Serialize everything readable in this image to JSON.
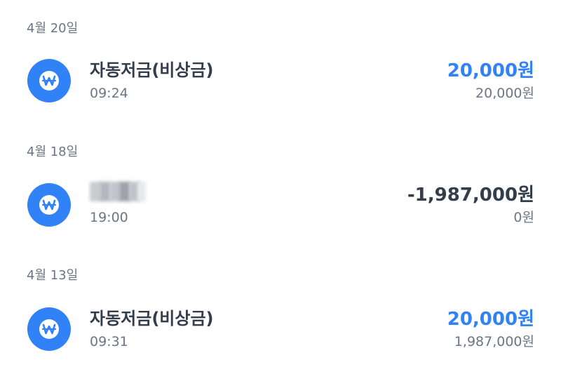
{
  "groups": [
    {
      "date": "4월 20일",
      "tx": {
        "title": "자동저금(비상금)",
        "time": "09:24",
        "amount": "20,000원",
        "balance": "20,000원",
        "direction": "in",
        "icon": "won-icon"
      }
    },
    {
      "date": "4월 18일",
      "tx": {
        "title_obscured": true,
        "time": "19:00",
        "amount": "-1,987,000원",
        "balance": "0원",
        "direction": "out",
        "icon": "won-icon"
      }
    },
    {
      "date": "4월 13일",
      "tx": {
        "title": "자동저금(비상금)",
        "time": "09:31",
        "amount": "20,000원",
        "balance": "1,987,000원",
        "direction": "in",
        "icon": "won-icon"
      }
    }
  ],
  "colors": {
    "accent_blue": "#3182f6",
    "text_primary": "#333d4b",
    "text_secondary": "#6b7684"
  }
}
